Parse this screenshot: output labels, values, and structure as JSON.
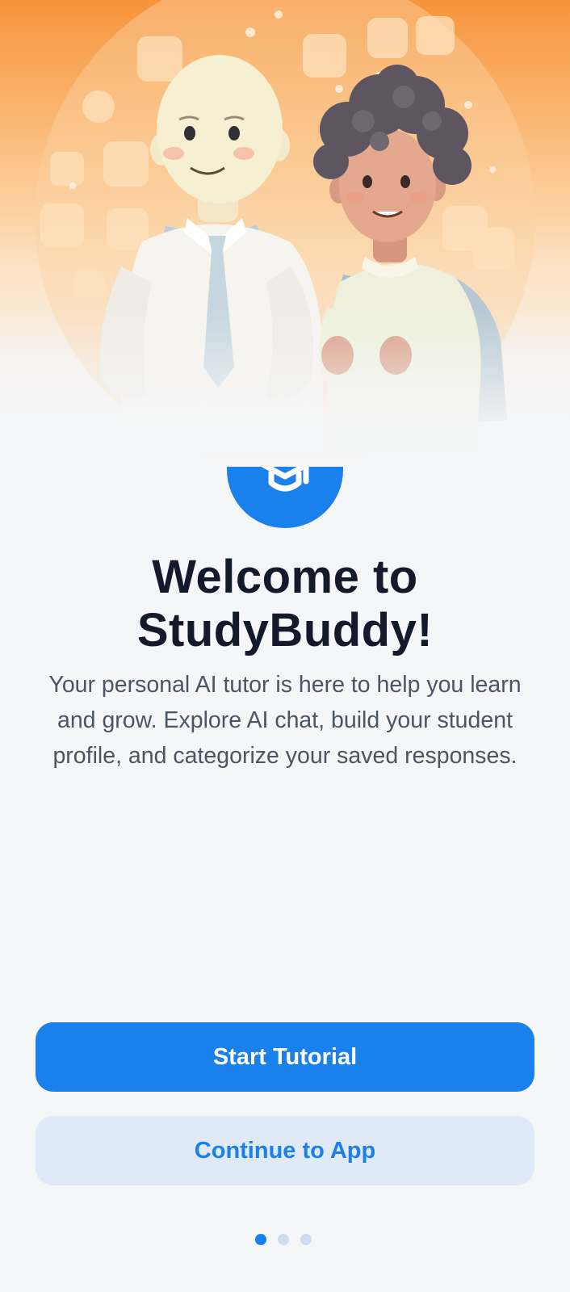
{
  "onboarding": {
    "title": "Welcome to StudyBuddy!",
    "description": "Your personal AI tutor is here to help you learn and grow. Explore AI chat, build your student profile, and categorize your saved responses.",
    "primary_button": "Start Tutorial",
    "secondary_button": "Continue to App",
    "page_indicator": {
      "total": 3,
      "active": 1
    }
  },
  "icons": {
    "logo": "graduation-cap-icon"
  },
  "colors": {
    "accent": "#1a80ec",
    "hero_orange": "#f7933a",
    "title": "#141a2b",
    "body_text": "#4b5563",
    "secondary_button_bg": "#e0e9f6",
    "background": "#f5f6f8"
  }
}
